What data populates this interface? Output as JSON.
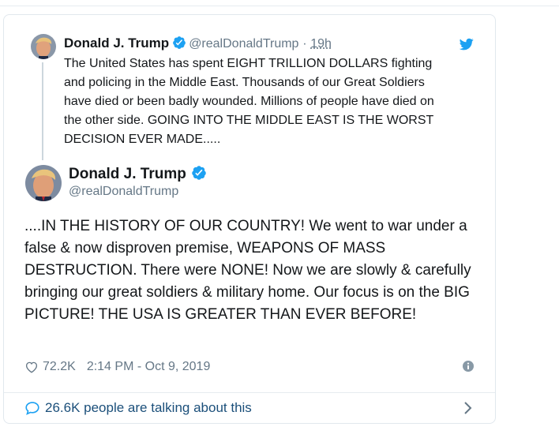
{
  "parent_tweet": {
    "author_name": "Donald J. Trump",
    "handle": "@realDonaldTrump",
    "separator": "·",
    "time": "19h",
    "text": "The United States has spent EIGHT TRILLION DOLLARS fighting\nand policing in the Middle East. Thousands of our Great Soldiers\nhave died or been badly wounded. Millions of people have died on\nthe other side. GOING INTO THE MIDDLE EAST IS THE WORST\nDECISION EVER MADE....."
  },
  "main_tweet": {
    "author_name": "Donald J. Trump",
    "handle": "@realDonaldTrump",
    "text": "....IN THE HISTORY OF OUR COUNTRY! We went to war under a false & now disproven premise, WEAPONS OF MASS DESTRUCTION. There were NONE! Now we are slowly & carefully bringing our great soldiers & military home. Our focus is on the BIG PICTURE! THE USA IS GREATER THAN EVER BEFORE!",
    "likes": "72.2K",
    "timestamp": "2:14 PM - Oct 9, 2019",
    "talking": "26.6K people are talking about this"
  },
  "icons": {
    "verified": "verified-badge-icon",
    "bird": "twitter-bird-icon",
    "heart": "heart-icon",
    "info": "info-icon",
    "bubble": "speech-bubble-icon",
    "chevron": "chevron-right-icon"
  },
  "colors": {
    "brand": "#1da1f2",
    "text": "#14171a",
    "muted": "#657786",
    "border": "#e1e8ed",
    "link": "#1b4f7a"
  }
}
